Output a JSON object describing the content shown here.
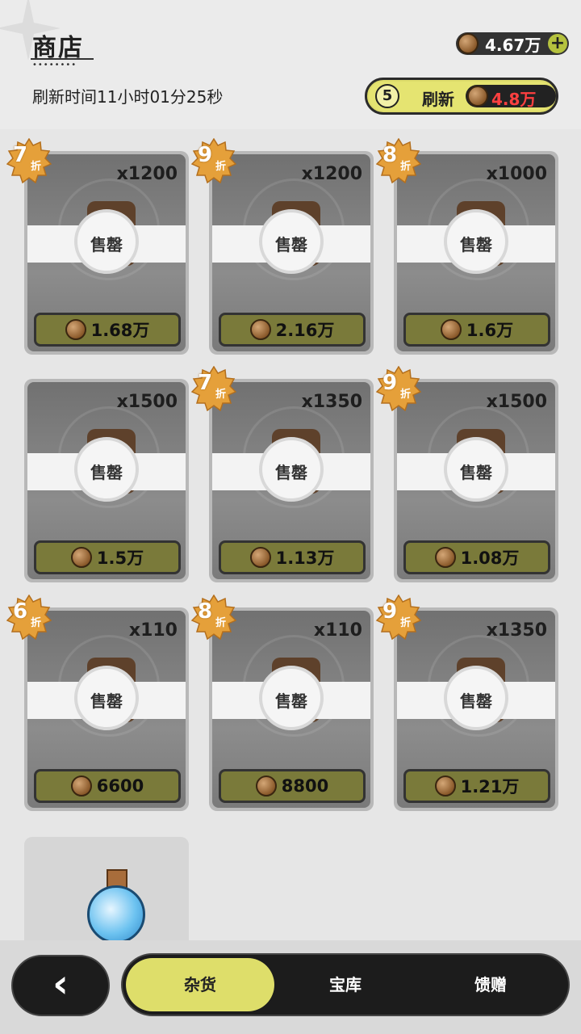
{
  "header": {
    "title": "商店",
    "refresh_time": "刷新时间11小时01分25秒",
    "currency": "4.67万",
    "plus": "+",
    "refresh_button": {
      "count": "5",
      "label": "刷新",
      "cost": "4.8万"
    }
  },
  "items": [
    {
      "discount": "7",
      "qty": "x1200",
      "price": "1.68万",
      "status": "售罄"
    },
    {
      "discount": "9",
      "qty": "x1200",
      "price": "2.16万",
      "status": "售罄"
    },
    {
      "discount": "8",
      "qty": "x1000",
      "price": "1.6万",
      "status": "售罄"
    },
    {
      "discount": "",
      "qty": "x1500",
      "price": "1.5万",
      "status": "售罄"
    },
    {
      "discount": "7",
      "qty": "x1350",
      "price": "1.13万",
      "status": "售罄"
    },
    {
      "discount": "9",
      "qty": "x1500",
      "price": "1.08万",
      "status": "售罄"
    },
    {
      "discount": "6",
      "qty": "x110",
      "price": "6600",
      "status": "售罄"
    },
    {
      "discount": "8",
      "qty": "x110",
      "price": "8800",
      "status": "售罄"
    },
    {
      "discount": "9",
      "qty": "x1350",
      "price": "1.21万",
      "status": "售罄"
    }
  ],
  "discount_suffix": "折",
  "tabs": [
    {
      "label": "杂货",
      "active": true
    },
    {
      "label": "宝库",
      "active": false
    },
    {
      "label": "馈赠",
      "active": false
    }
  ],
  "back_icon": "chevron-left-icon",
  "colors": {
    "accent": "#dede6a",
    "price_btn": "#7a7a3a",
    "cost_red": "#ff4040"
  }
}
